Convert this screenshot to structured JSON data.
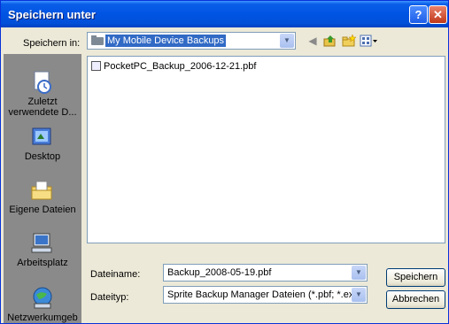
{
  "window": {
    "title": "Speichern unter",
    "help_label": "?",
    "close_label": "✕"
  },
  "toolbar": {
    "save_in_label": "Speichern in:",
    "save_in_value": "My Mobile Device Backups",
    "icons": [
      "back-icon",
      "up-folder-icon",
      "new-folder-icon",
      "view-menu-icon"
    ]
  },
  "places": [
    {
      "label": "Zuletzt verwendete D...",
      "icon": "recent-documents-icon"
    },
    {
      "label": "Desktop",
      "icon": "desktop-icon"
    },
    {
      "label": "Eigene Dateien",
      "icon": "my-documents-icon"
    },
    {
      "label": "Arbeitsplatz",
      "icon": "my-computer-icon"
    },
    {
      "label": "Netzwerkumgeb",
      "icon": "network-icon"
    }
  ],
  "files": [
    {
      "name": "PocketPC_Backup_2006-12-21.pbf"
    }
  ],
  "filename": {
    "label": "Dateiname:",
    "value": "Backup_2008-05-19.pbf"
  },
  "filetype": {
    "label": "Dateityp:",
    "value": "Sprite Backup Manager Dateien (*.pbf; *.exe)"
  },
  "buttons": {
    "save": "Speichern",
    "cancel": "Abbrechen"
  }
}
